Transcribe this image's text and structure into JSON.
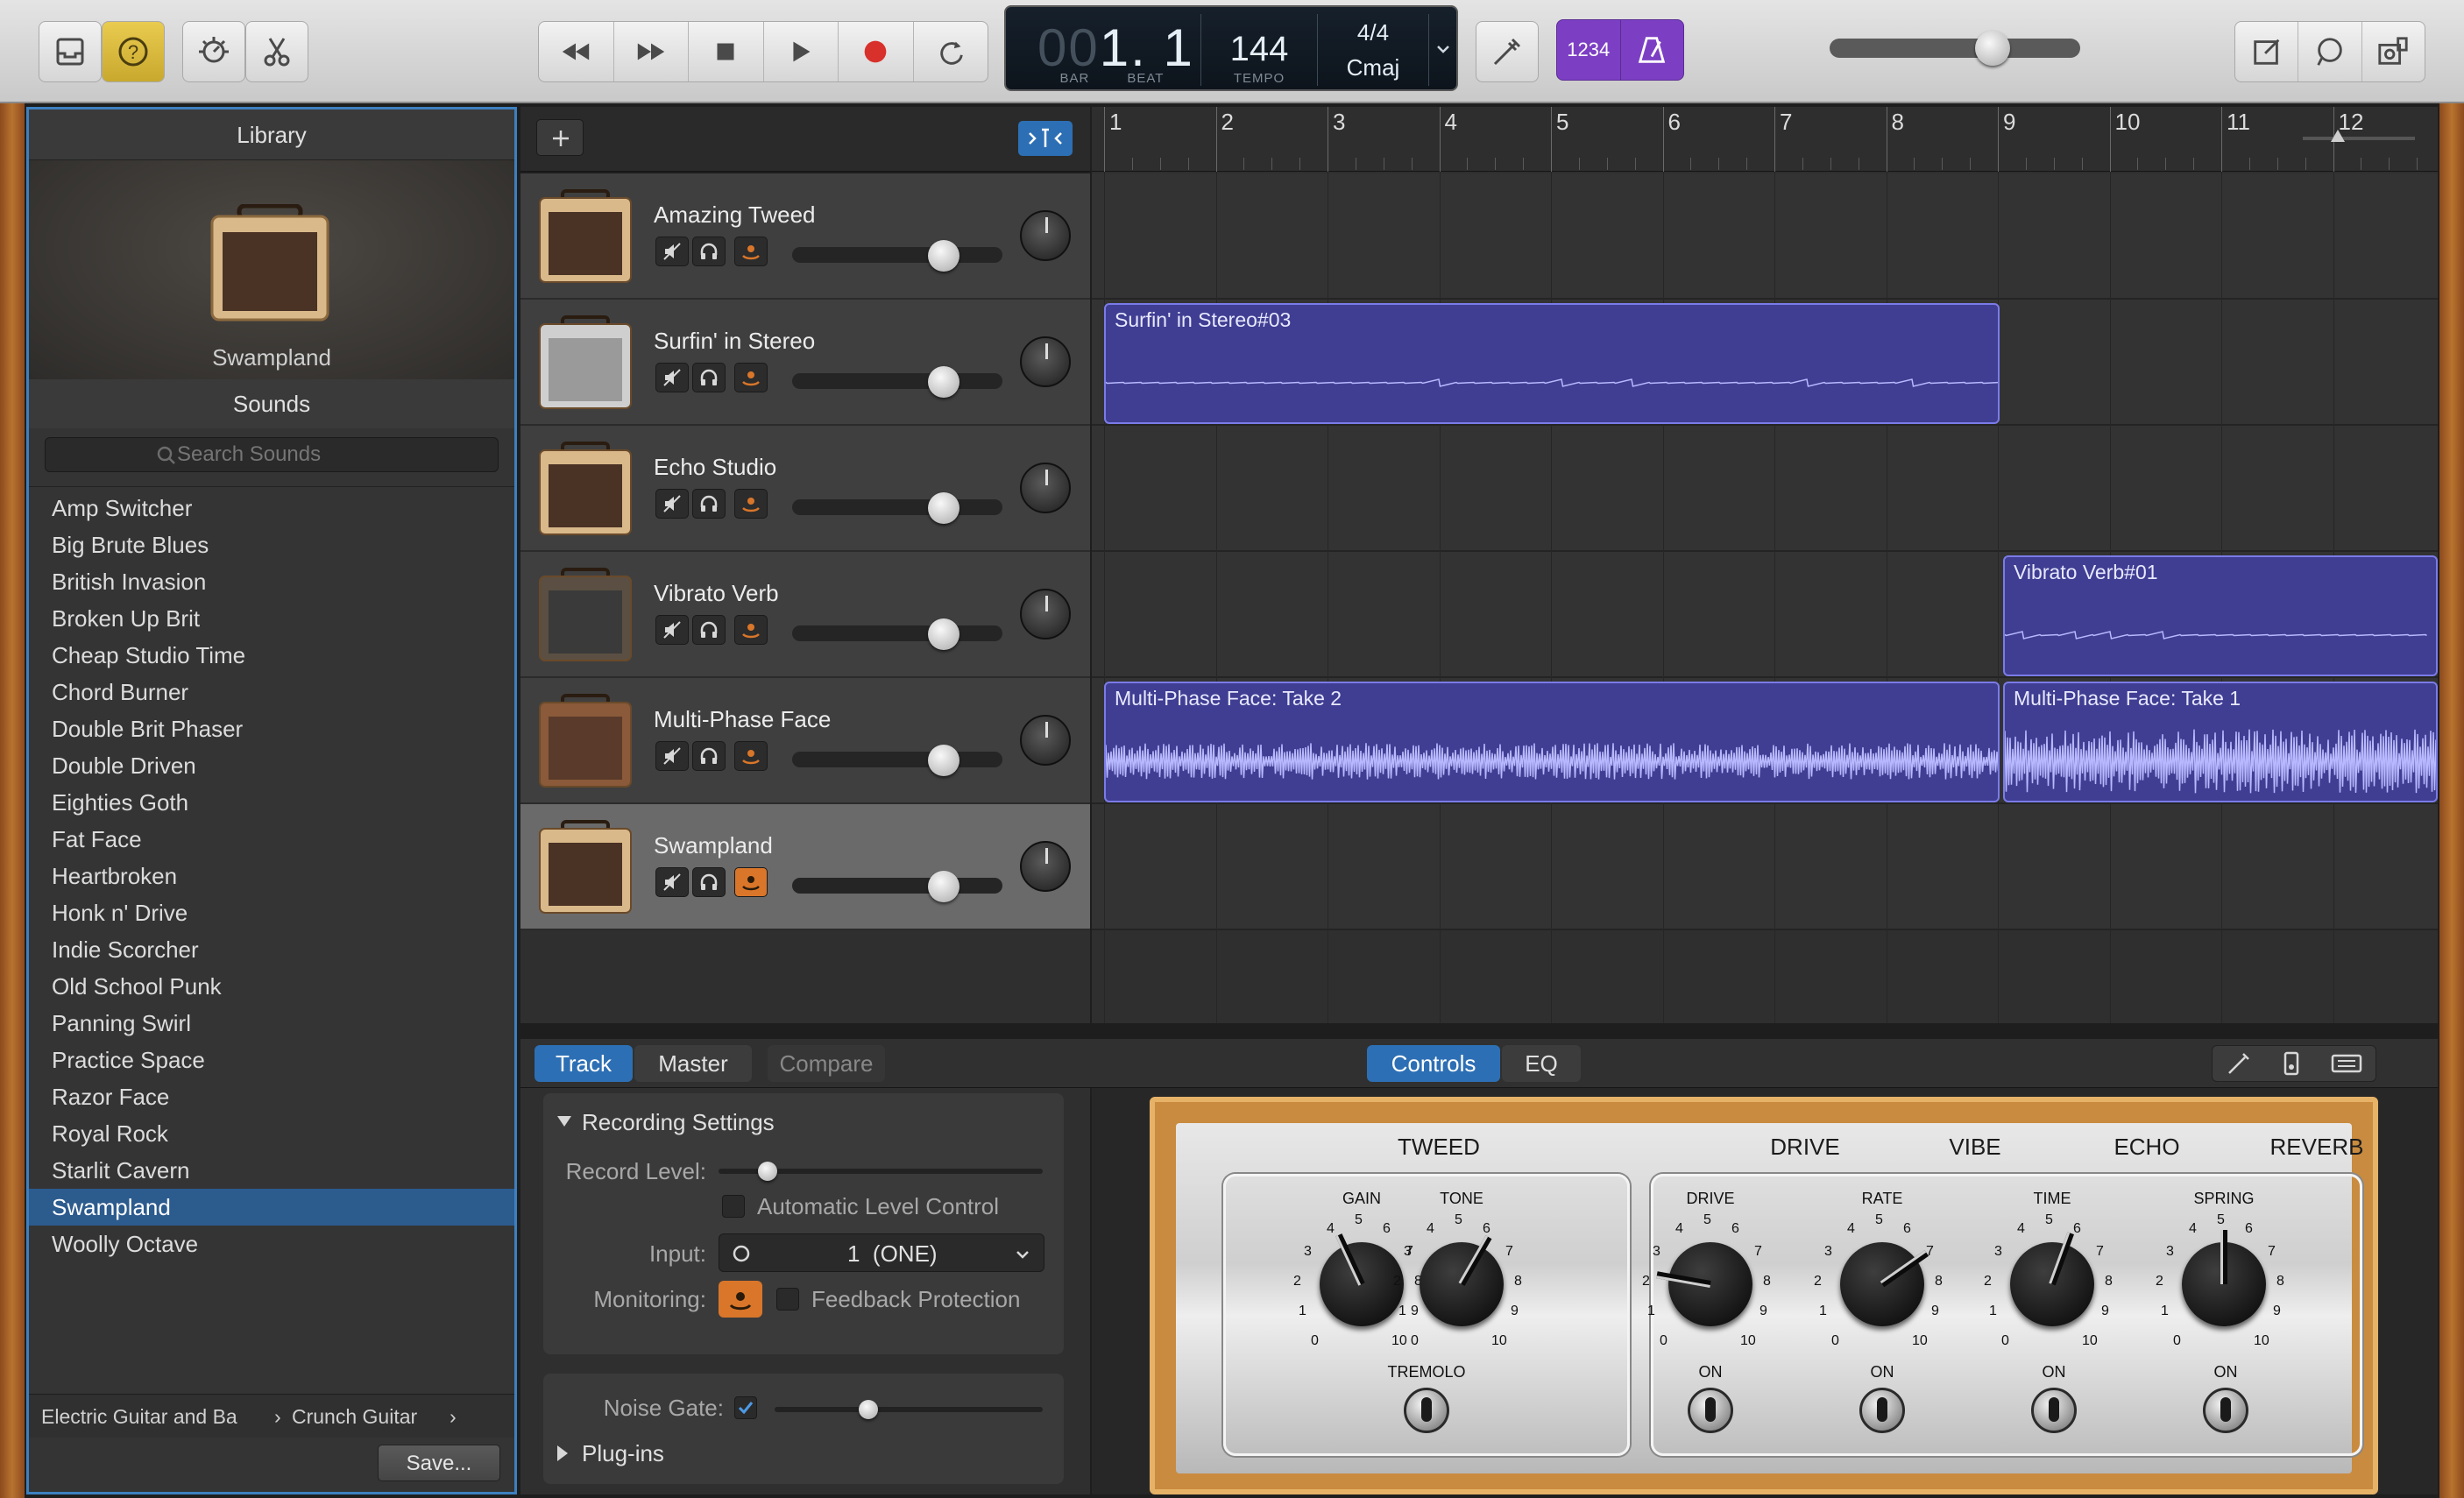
{
  "transport": {
    "bar_dim": "00",
    "bar": "1",
    "beat": "1",
    "bar_label": "BAR",
    "beat_label": "BEAT",
    "tempo": "144",
    "tempo_label": "TEMPO",
    "time_signature": "4/4",
    "key": "Cmaj",
    "count_in": "1234",
    "master_volume": 0.65
  },
  "library": {
    "title": "Library",
    "preset_name": "Swampland",
    "sounds_label": "Sounds",
    "search_placeholder": "Search Sounds",
    "items": [
      "Amp Switcher",
      "Big Brute Blues",
      "British Invasion",
      "Broken Up Brit",
      "Cheap Studio Time",
      "Chord Burner",
      "Double Brit Phaser",
      "Double Driven",
      "Eighties Goth",
      "Fat Face",
      "Heartbroken",
      "Honk n' Drive",
      "Indie Scorcher",
      "Old School Punk",
      "Panning Swirl",
      "Practice Space",
      "Razor Face",
      "Royal Rock",
      "Starlit Cavern",
      "Swampland",
      "Woolly Octave"
    ],
    "selected": "Swampland",
    "breadcrumb_1": "Electric Guitar and Ba",
    "breadcrumb_2": "Crunch Guitar",
    "save_label": "Save..."
  },
  "tracks": [
    {
      "name": "Amazing Tweed",
      "volume": 0.72
    },
    {
      "name": "Surfin' in Stereo",
      "volume": 0.72
    },
    {
      "name": "Echo Studio",
      "volume": 0.72
    },
    {
      "name": "Vibrato Verb",
      "volume": 0.72
    },
    {
      "name": "Multi-Phase Face",
      "volume": 0.72
    },
    {
      "name": "Swampland",
      "volume": 0.72
    }
  ],
  "ruler": {
    "bars": [
      "1",
      "2",
      "3",
      "4",
      "5",
      "6",
      "7",
      "8",
      "9",
      "10",
      "11",
      "12"
    ]
  },
  "regions": [
    {
      "name": "Surfin' in Stereo#03"
    },
    {
      "name": "Vibrato Verb#01"
    },
    {
      "name": "Multi-Phase Face: Take 2"
    },
    {
      "name": "Multi-Phase Face: Take 1"
    }
  ],
  "bottom": {
    "tab_track": "Track",
    "tab_master": "Master",
    "compare": "Compare",
    "tab_controls": "Controls",
    "tab_eq": "EQ"
  },
  "recording": {
    "header": "Recording Settings",
    "record_level_label": "Record Level:",
    "record_level": 0.15,
    "auto_level_label": "Automatic Level Control",
    "input_label": "Input:",
    "input_value": "1  (ONE)",
    "monitoring_label": "Monitoring:",
    "feedback_label": "Feedback Protection",
    "noise_gate_label": "Noise Gate:",
    "noise_gate_level": 0.35,
    "plugins_label": "Plug-ins"
  },
  "amp": {
    "section_tweed": "TWEED",
    "section_drive": "DRIVE",
    "section_vibe": "VIBE",
    "section_echo": "ECHO",
    "section_reverb": "REVERB",
    "knob_gain": "GAIN",
    "knob_tone": "TONE",
    "knob_drive": "DRIVE",
    "knob_rate": "RATE",
    "knob_time": "TIME",
    "knob_spring": "SPRING",
    "tremolo": "TREMOLO",
    "on_label": "ON",
    "scale": [
      "0",
      "1",
      "2",
      "3",
      "4",
      "5",
      "6",
      "7",
      "8",
      "9",
      "10"
    ]
  },
  "colors": {
    "accent": "#3d80c0",
    "region": "#3f3e92",
    "monitor": "#d9762a",
    "countin": "#7c3fc4"
  }
}
